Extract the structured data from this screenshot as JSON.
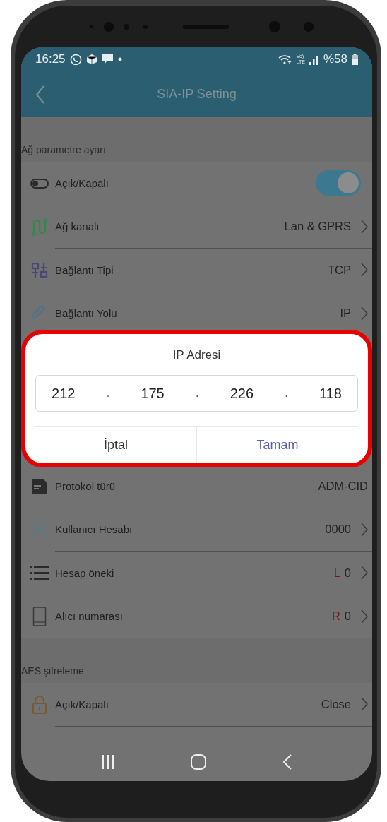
{
  "status_bar": {
    "time": "16:25",
    "volte": "Vo)",
    "lte": "LTE",
    "battery": "%58"
  },
  "app_bar": {
    "title": "SIA-IP Setting"
  },
  "sections": [
    {
      "title": "Ağ parametre ayarı",
      "rows": [
        {
          "kind": "switch",
          "label": "Açık/Kapalı",
          "on": true
        },
        {
          "kind": "value",
          "label": "Ağ kanalı",
          "value": "Lan & GPRS",
          "chevron": true
        },
        {
          "kind": "value",
          "label": "Bağlantı Tipi",
          "value": "TCP",
          "chevron": true
        },
        {
          "kind": "value",
          "label": "Bağlantı Yolu",
          "value": "IP",
          "chevron": true
        }
      ],
      "rows_below_dialog": [
        {
          "kind": "value",
          "label": "Protokol türü",
          "value": "ADM-CID",
          "chevron": false
        },
        {
          "kind": "value",
          "label": "Kullanıcı Hesabı",
          "value": "0000",
          "chevron": true
        },
        {
          "kind": "value",
          "label": "Hesap öneki",
          "value_prefix": "L",
          "value": "0",
          "chevron": true
        },
        {
          "kind": "value",
          "label": "Alıcı numarası",
          "value_prefix": "R",
          "value": "0",
          "chevron": true
        }
      ]
    },
    {
      "title": "AES şifreleme",
      "rows": [
        {
          "kind": "value",
          "label": "Açık/Kapalı",
          "value": "Close",
          "chevron": true
        }
      ]
    }
  ],
  "dialog": {
    "title": "IP Adresi",
    "octets": [
      "212",
      "175",
      "226",
      "118"
    ],
    "separator": ".",
    "buttons": [
      {
        "label": "İptal",
        "primary": false
      },
      {
        "label": "Tamam",
        "primary": true
      }
    ]
  }
}
